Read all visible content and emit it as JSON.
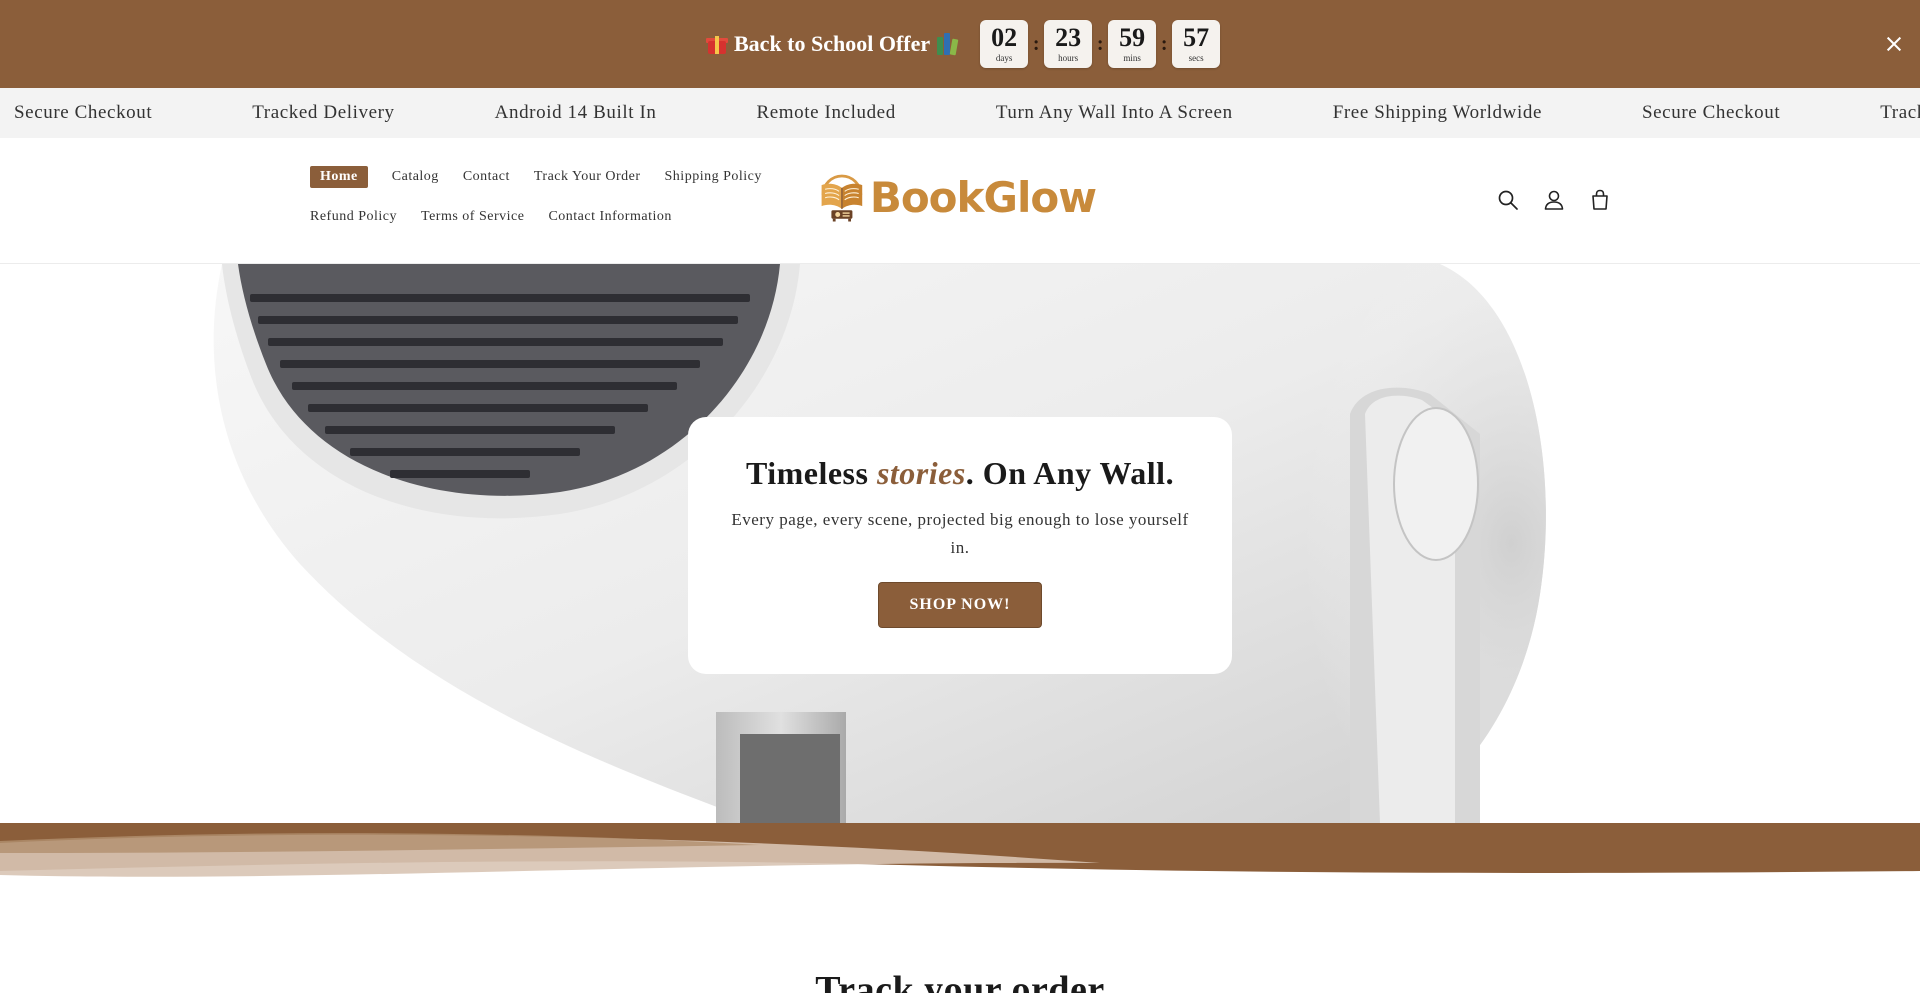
{
  "announcement": {
    "offer_text": "Back to School Offer",
    "countdown": [
      {
        "value": "02",
        "label": "days"
      },
      {
        "value": "23",
        "label": "hours"
      },
      {
        "value": "59",
        "label": "mins"
      },
      {
        "value": "57",
        "label": "secs"
      }
    ],
    "separator": ":",
    "bg_color": "#8b5e3a"
  },
  "marquee": {
    "items": [
      "Secure Checkout",
      "Tracked Delivery",
      "Android 14 Built In",
      "Remote Included",
      "Turn Any Wall Into A Screen",
      "Free Shipping Worldwide",
      "Secure Checkout",
      "Tracked Delivery"
    ]
  },
  "nav": {
    "row1": [
      "Home",
      "Catalog",
      "Contact",
      "Track Your Order",
      "Shipping Policy"
    ],
    "row2": [
      "Refund Policy",
      "Terms of Service",
      "Contact Information"
    ],
    "active": "Home"
  },
  "logo": {
    "text": "BookGlow"
  },
  "header_icons": [
    "search-icon",
    "account-icon",
    "cart-icon"
  ],
  "hero": {
    "title_before": "Timeless ",
    "title_accent": "stories",
    "title_after": ". On Any Wall.",
    "subtitle": "Every page, every scene, projected big enough to lose yourself in.",
    "cta": "SHOP NOW!"
  },
  "section": {
    "title": "Track your order"
  },
  "colors": {
    "brand": "#8b5e3a",
    "accent_gold": "#c88a3b"
  }
}
